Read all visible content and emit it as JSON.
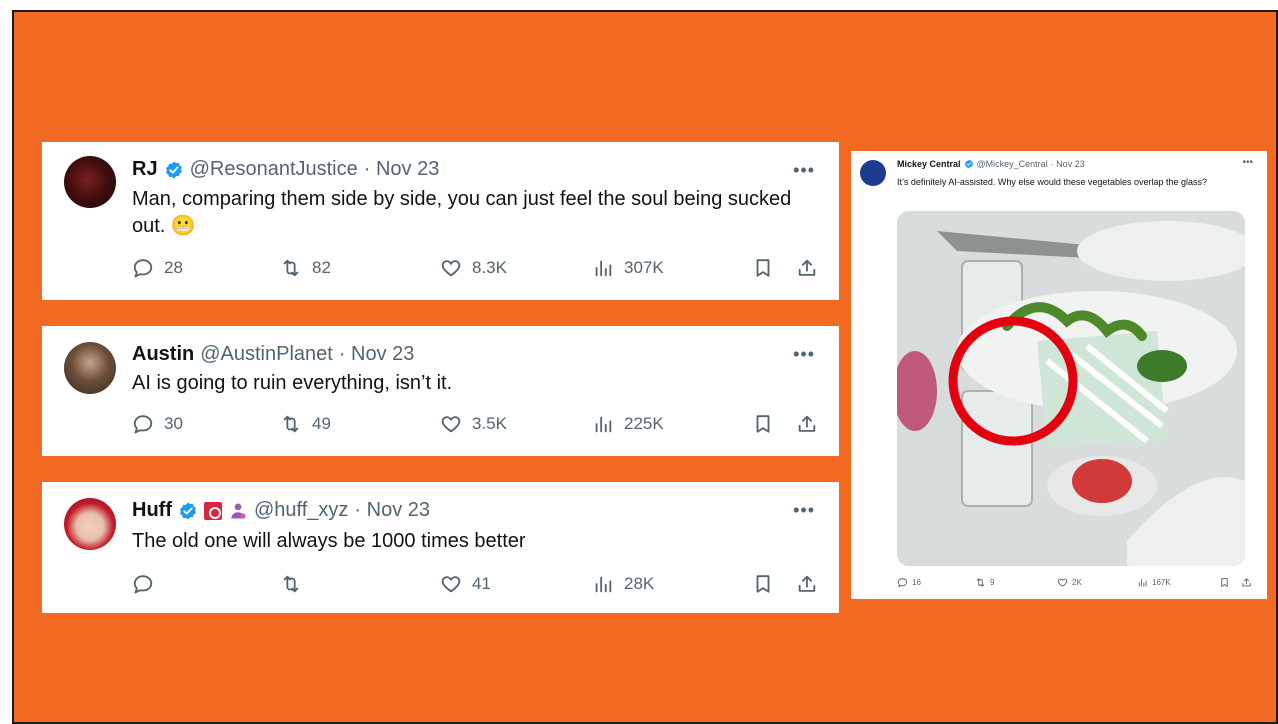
{
  "colors": {
    "background": "#F26A21",
    "verified": "#1D9BF0",
    "annotation_circle": "#E3000F"
  },
  "tweets": [
    {
      "name": "RJ",
      "handle": "@ResonantJustice",
      "date": "· Nov 23",
      "text": "Man, comparing them side by side, you can just feel the soul being sucked out. 😬",
      "replies": "28",
      "retweets": "82",
      "likes": "8.3K",
      "views": "307K"
    },
    {
      "name": "Austin",
      "handle": "@AustinPlanet",
      "date": "· Nov 23",
      "text": "AI is going to ruin everything, isn’t it.",
      "replies": "30",
      "retweets": "49",
      "likes": "3.5K",
      "views": "225K"
    },
    {
      "name": "Huff",
      "handle": "@huff_xyz",
      "date": "· Nov 23",
      "text": "The old one will always be 1000 times better",
      "replies": "",
      "retweets": "",
      "likes": "41",
      "views": "28K"
    }
  ],
  "mickey": {
    "name": "Mickey Central",
    "handle": "@Mickey_Central",
    "date": "· Nov 23",
    "text": "It’s definitely AI-assisted. Why else would these vegetables overlap the glass?",
    "replies": "16",
    "retweets": "9",
    "likes": "2K",
    "views": "167K"
  },
  "icons": {
    "more": "more-icon",
    "reply": "reply-icon",
    "retweet": "retweet-icon",
    "like": "heart-icon",
    "views": "views-icon",
    "bookmark": "bookmark-icon",
    "share": "share-icon",
    "verified": "verified-badge-icon"
  }
}
